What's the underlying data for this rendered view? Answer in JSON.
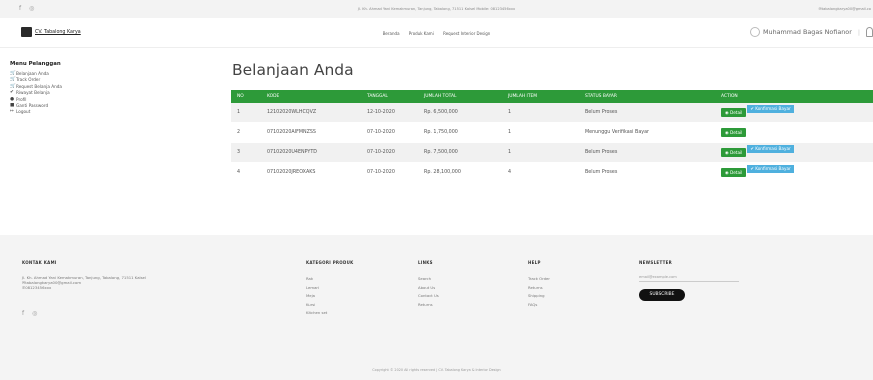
{
  "topbar": {
    "address": "Jl. Kh. Ahmad Yani Kemakmuran, Tanjung, Tabalong, 71511 Kalsel Mobile: 08123456xxx",
    "email": "tabalongkarya00@gmail.co"
  },
  "navbar": {
    "brand": "CV. Tabalong Karya",
    "menu": [
      "Beranda",
      "Produk Kami",
      "Request Interior Design"
    ],
    "user": "Muhammad Bagas Nofianor"
  },
  "sidebar": {
    "heading": "Menu Pelanggan",
    "items": [
      {
        "label": "Belanjaan Anda",
        "icon": "cart-icon"
      },
      {
        "label": "Track Order",
        "icon": "cart-icon"
      },
      {
        "label": "Request Belanja Anda",
        "icon": "cart-icon"
      },
      {
        "label": "Riwayat Belanja",
        "icon": "check-icon"
      },
      {
        "label": "Profil",
        "icon": "user-icon"
      },
      {
        "label": "Ganti Password",
        "icon": "lock-icon"
      },
      {
        "label": "Logout",
        "icon": "logout-icon"
      }
    ]
  },
  "page": {
    "title": "Belanjaan Anda"
  },
  "table": {
    "headers": [
      "NO",
      "KODE",
      "TANGGAL",
      "JUMLAH TOTAL",
      "JUMLAH ITEM",
      "STATUS BAYAR",
      "ACTION"
    ],
    "rows": [
      {
        "no": "1",
        "kode": "12102020WLHCQVZ",
        "tanggal": "12-10-2020",
        "total": "Rp. 6,500,000",
        "item": "1",
        "status": "Belum Proses",
        "konfirmasi": true
      },
      {
        "no": "2",
        "kode": "07102020AIFMNZSS",
        "tanggal": "07-10-2020",
        "total": "Rp. 1,750,000",
        "item": "1",
        "status": "Menunggu Verifikasi Bayar",
        "konfirmasi": false
      },
      {
        "no": "3",
        "kode": "07102020U4ENPYTD",
        "tanggal": "07-10-2020",
        "total": "Rp. 7,500,000",
        "item": "1",
        "status": "Belum Proses",
        "konfirmasi": true
      },
      {
        "no": "4",
        "kode": "07102020JREOXAKS",
        "tanggal": "07-10-2020",
        "total": "Rp. 28,100,000",
        "item": "4",
        "status": "Belum Proses",
        "konfirmasi": true
      }
    ],
    "detail_label": "Detail",
    "konfirmasi_label": "Konfirmasi Bayar"
  },
  "footer": {
    "kontak": {
      "heading": "KONTAK KAMI",
      "lines": [
        "Jl. Kh. Ahmad Yani Kemakmuran, Tanjung, Tabalong, 71511 Kalsel",
        "tabalongkarya00@gmail.com",
        "08123456xxx"
      ]
    },
    "kategori": {
      "heading": "KATEGORI PRODUK",
      "items": [
        "Rak",
        "Lemari",
        "Meja",
        "Kursi",
        "Kitchen set"
      ]
    },
    "links": {
      "heading": "LINKS",
      "items": [
        "Search",
        "About Us",
        "Contact Us",
        "Returns"
      ]
    },
    "help": {
      "heading": "HELP",
      "items": [
        "Track Order",
        "Returns",
        "Shipping",
        "FAQs"
      ]
    },
    "newsletter": {
      "heading": "NEWSLETTER",
      "placeholder": "email@example.com",
      "button": "SUBSCRIBE"
    },
    "copyright": "Copyright © 2020 All rights reserved | CV. Tabalong Karya & Interior Design"
  },
  "colors": {
    "accent": "#2d9a39",
    "info": "#4fb0de"
  }
}
